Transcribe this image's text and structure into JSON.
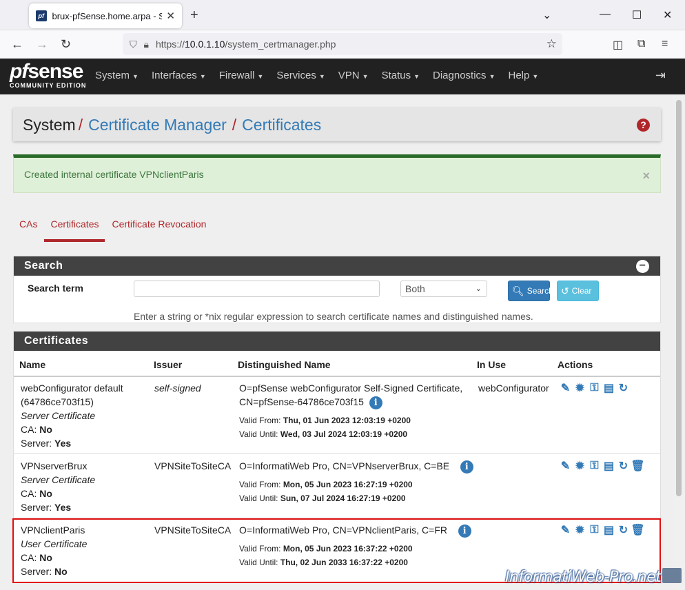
{
  "browser": {
    "tab_title": "brux-pfSense.home.arpa - Syst",
    "favicon": "pf",
    "url_prefix": "https://",
    "url_host": "10.0.1.10",
    "url_path": "/system_certmanager.php"
  },
  "pfsense": {
    "logo_text_pf": "pf",
    "logo_text_sense": "sense",
    "logo_edition": "COMMUNITY EDITION",
    "menu": [
      "System",
      "Interfaces",
      "Firewall",
      "Services",
      "VPN",
      "Status",
      "Diagnostics",
      "Help"
    ]
  },
  "breadcrumb": {
    "root": "System",
    "level1": "Certificate Manager",
    "level2": "Certificates",
    "sep": "/"
  },
  "alert": {
    "message": "Created internal certificate VPNclientParis",
    "close": "×"
  },
  "tabs": [
    "CAs",
    "Certificates",
    "Certificate Revocation"
  ],
  "search": {
    "title": "Search",
    "term_label": "Search term",
    "input_value": "",
    "select_value": "Both",
    "search_button": "Search",
    "clear_button": "Clear",
    "help": "Enter a string or *nix regular expression to search certificate names and distinguished names."
  },
  "certificates": {
    "title": "Certificates",
    "columns": [
      "Name",
      "Issuer",
      "Distinguished Name",
      "In Use",
      "Actions"
    ],
    "rows": [
      {
        "name1": "webConfigurator default",
        "name2": "(64786ce703f15)",
        "type": "Server Certificate",
        "ca_label": "CA:",
        "ca": "No",
        "server_label": "Server:",
        "server": "Yes",
        "issuer": "self-signed",
        "dn1": "O=pfSense webConfigurator Self-Signed Certificate,",
        "dn2": "CN=pfSense-64786ce703f15",
        "valid_from_label": "Valid From:",
        "valid_from": "Thu, 01 Jun 2023 12:03:19 +0200",
        "valid_until_label": "Valid Until:",
        "valid_until": "Wed, 03 Jul 2024 12:03:19 +0200",
        "in_use": "webConfigurator"
      },
      {
        "name1": "VPNserverBrux",
        "type": "Server Certificate",
        "ca_label": "CA:",
        "ca": "No",
        "server_label": "Server:",
        "server": "Yes",
        "issuer": "VPNSiteToSiteCA",
        "dn1": "O=InformatiWeb Pro, CN=VPNserverBrux, C=BE",
        "valid_from_label": "Valid From:",
        "valid_from": "Mon, 05 Jun 2023 16:27:19 +0200",
        "valid_until_label": "Valid Until:",
        "valid_until": "Sun, 07 Jul 2024 16:27:19 +0200",
        "in_use": ""
      },
      {
        "name1": "VPNclientParis",
        "type": "User Certificate",
        "ca_label": "CA:",
        "ca": "No",
        "server_label": "Server:",
        "server": "No",
        "issuer": "VPNSiteToSiteCA",
        "dn1": "O=InformatiWeb Pro, CN=VPNclientParis, C=FR",
        "valid_from_label": "Valid From:",
        "valid_from": "Mon, 05 Jun 2023 16:37:22 +0200",
        "valid_until_label": "Valid Until:",
        "valid_until": "Thu, 02 Jun 2033 16:37:22 +0200",
        "in_use": ""
      }
    ]
  },
  "watermark": "InformatiWeb-Pro.net",
  "colors": {
    "brand_red": "#b0272b",
    "link_blue": "#337ab7",
    "nav_dark": "#212121",
    "highlight": "#e01010"
  }
}
